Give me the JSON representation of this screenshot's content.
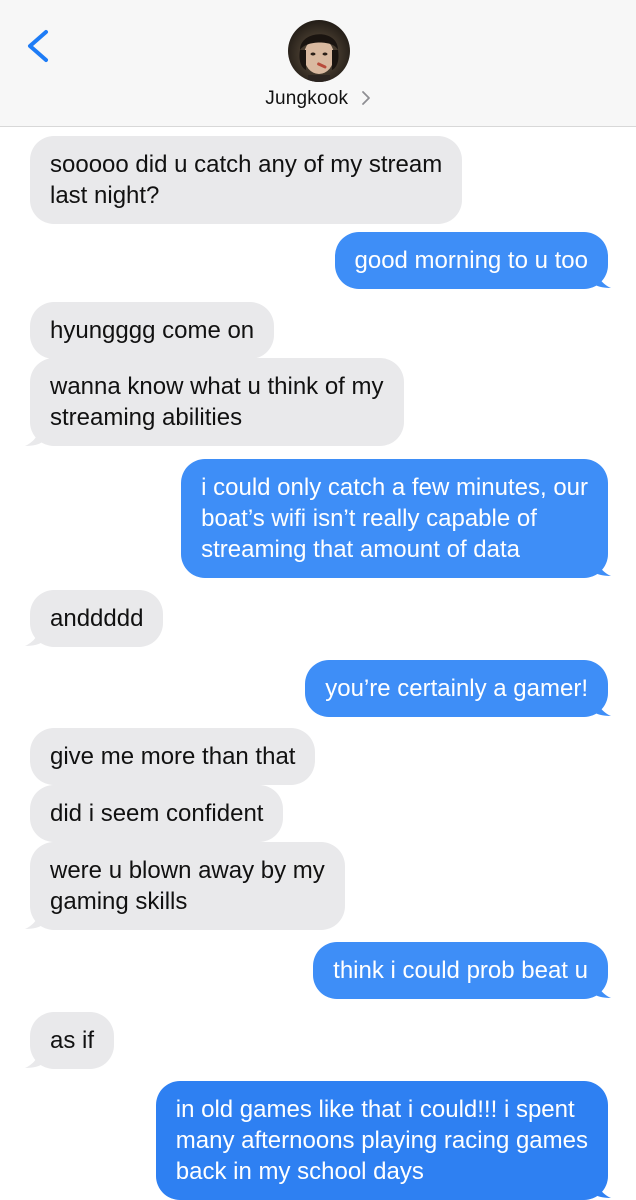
{
  "header": {
    "contact_name": "Jungkook",
    "back_icon": "chevron-left-icon",
    "detail_icon": "chevron-right-icon"
  },
  "colors": {
    "incoming_bubble": "#e9e9eb",
    "outgoing_bubble": "#3e8ef7",
    "accent": "#1e7cf6"
  },
  "messages": [
    {
      "from": "contact",
      "lines": [
        "sooooo did u catch any of my stream",
        "last night?"
      ]
    },
    {
      "from": "me",
      "lines": [
        "good morning to u too"
      ]
    },
    {
      "from": "contact",
      "lines": [
        "hyungggg come on"
      ]
    },
    {
      "from": "contact",
      "lines": [
        "wanna know what u think of my",
        "streaming abilities"
      ]
    },
    {
      "from": "me",
      "lines": [
        "i could only catch a few minutes, our",
        "boat’s wifi isn’t really capable of",
        "streaming that amount of data"
      ]
    },
    {
      "from": "contact",
      "lines": [
        "anddddd"
      ]
    },
    {
      "from": "me",
      "lines": [
        "you’re certainly a gamer!"
      ]
    },
    {
      "from": "contact",
      "lines": [
        "give me more than that"
      ]
    },
    {
      "from": "contact",
      "lines": [
        "did i seem confident"
      ]
    },
    {
      "from": "contact",
      "lines": [
        "were u blown away by my",
        "gaming skills"
      ]
    },
    {
      "from": "me",
      "lines": [
        "think i could prob beat u"
      ]
    },
    {
      "from": "contact",
      "lines": [
        "as if"
      ]
    },
    {
      "from": "me",
      "lines": [
        "in old games like that i could!!! i spent",
        "many afternoons playing racing games",
        "back in my school days"
      ]
    }
  ]
}
